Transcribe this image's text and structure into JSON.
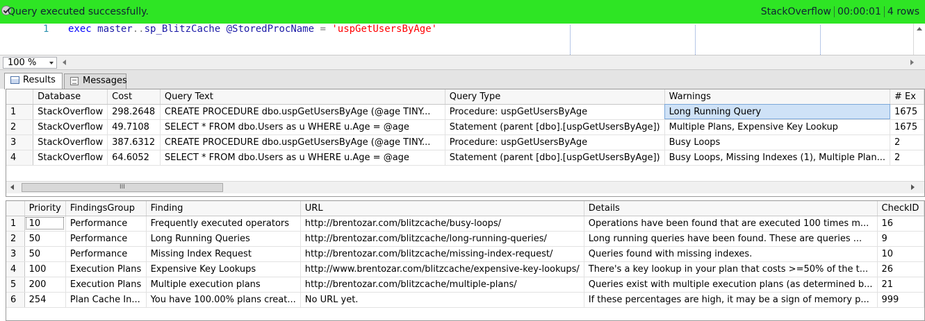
{
  "status": {
    "message": "Query executed successfully.",
    "server": "StackOverflow",
    "elapsed": "00:00:01",
    "rows": "4 rows",
    "color": "#2ee524"
  },
  "editor": {
    "line_number": "1",
    "tokens": {
      "exec": "exec",
      "space1": " ",
      "master": "master",
      "dots": "..",
      "proc": "sp_BlitzCache",
      "space2": " ",
      "param": "@StoredProcName",
      "eq": " = ",
      "value": "'uspGetUsersByAge'"
    }
  },
  "zoom": {
    "value": "100 %"
  },
  "tabs": {
    "results": "Results",
    "messages": "Messages"
  },
  "grid1": {
    "headers": [
      "",
      "Database",
      "Cost",
      "Query Text",
      "Query Type",
      "Warnings",
      "# Ex"
    ],
    "rows": [
      [
        "1",
        "StackOverflow",
        "298.2648",
        "CREATE PROCEDURE dbo.uspGetUsersByAge (@age TINY...",
        "Procedure: uspGetUsersByAge",
        "Long Running Query",
        "1675"
      ],
      [
        "2",
        "StackOverflow",
        "49.7108",
        "SELECT  *    FROM  dbo.Users as u    WHERE  u.Age = @age",
        "Statement (parent [dbo].[uspGetUsersByAge])",
        "Multiple Plans, Expensive Key Lookup",
        "1675"
      ],
      [
        "3",
        "StackOverflow",
        "387.6312",
        "CREATE PROCEDURE dbo.uspGetUsersByAge (@age TINY...",
        "Procedure: uspGetUsersByAge",
        "Busy Loops",
        "2"
      ],
      [
        "4",
        "StackOverflow",
        "64.6052",
        "SELECT  *    FROM  dbo.Users as u    WHERE  u.Age = @age",
        "Statement (parent [dbo].[uspGetUsersByAge])",
        "Busy Loops, Missing Indexes (1), Multiple Plan...",
        "2"
      ]
    ],
    "scroll_grip": "III"
  },
  "grid2": {
    "headers": [
      "",
      "Priority",
      "FindingsGroup",
      "Finding",
      "URL",
      "Details",
      "CheckID"
    ],
    "rows": [
      [
        "1",
        "10",
        "Performance",
        "Frequently executed operators",
        "http://brentozar.com/blitzcache/busy-loops/",
        "Operations have been found that are executed 100 times m...",
        "16"
      ],
      [
        "2",
        "50",
        "Performance",
        "Long Running Queries",
        "http://brentozar.com/blitzcache/long-running-queries/",
        "Long running queries have been found. These are queries ...",
        "9"
      ],
      [
        "3",
        "50",
        "Performance",
        "Missing Index Request",
        "http://brentozar.com/blitzcache/missing-index-request/",
        "Queries found with missing indexes.",
        "10"
      ],
      [
        "4",
        "100",
        "Execution Plans",
        "Expensive Key Lookups",
        "http://www.brentozar.com/blitzcache/expensive-key-lookups/",
        "There's a key lookup in your plan that costs >=50% of the t...",
        "26"
      ],
      [
        "5",
        "200",
        "Execution Plans",
        "Multiple execution plans",
        "http://brentozar.com/blitzcache/multiple-plans/",
        "Queries exist with multiple execution plans (as determined b...",
        "21"
      ],
      [
        "6",
        "254",
        "Plan Cache In...",
        "You have 100.00% plans creat...",
        "No URL yet.",
        "If these percentages are high, it may be a sign of memory p...",
        "999"
      ]
    ]
  }
}
